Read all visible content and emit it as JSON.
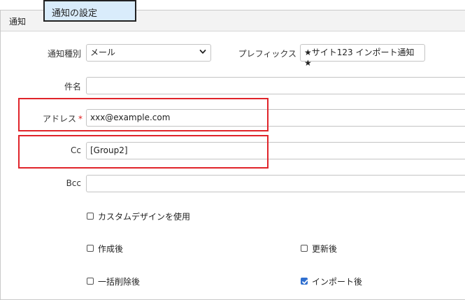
{
  "tooltip": {
    "text": "通知の設定"
  },
  "panel": {
    "title": "通知"
  },
  "form": {
    "type_label": "通知種別",
    "type_value": "メール",
    "prefix_label": "プレフィックス",
    "prefix_value": "★サイト123 インポート通知★",
    "subject_label": "件名",
    "subject_value": "",
    "address_label": "アドレス",
    "address_required_mark": "*",
    "address_value": "xxx@example.com",
    "cc_label": "Cc",
    "cc_value": "[Group2]",
    "bcc_label": "Bcc",
    "bcc_value": ""
  },
  "options": {
    "custom_design": {
      "label": "カスタムデザインを使用",
      "checked": false
    },
    "after_create": {
      "label": "作成後",
      "checked": false
    },
    "after_update": {
      "label": "更新後",
      "checked": false
    },
    "after_bulk_delete": {
      "label": "一括削除後",
      "checked": false
    },
    "after_import": {
      "label": "インポート後",
      "checked": true
    }
  },
  "colors": {
    "highlight_border": "#e0242a",
    "tooltip_bg": "#d9ecfb",
    "checkbox_checked": "#2f6fcf",
    "required_mark": "#e01b1b"
  },
  "icons": {
    "select_arrow": "chevron-down-icon",
    "checked_mark": "checkmark-icon"
  }
}
